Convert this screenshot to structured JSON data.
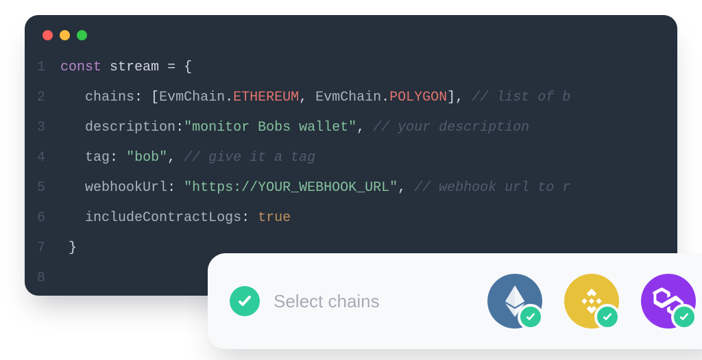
{
  "window": {
    "dots": {
      "red": "#fc605c",
      "yellow": "#fdbc40",
      "green": "#34c749"
    }
  },
  "code": {
    "line_numbers": [
      "1",
      "2",
      "3",
      "4",
      "5",
      "6",
      "7",
      "8"
    ],
    "l1": {
      "kw": "const",
      "id": "stream",
      "eq": " = ",
      "brace": "{"
    },
    "l2": {
      "key": "chains",
      "colon": ": [",
      "cls1": "EvmChain",
      "dot1": ".",
      "enum1": "ETHEREUM",
      "sep": ", ",
      "cls2": "EvmChain",
      "dot2": ".",
      "enum2": "POLYGON",
      "close": "], ",
      "comment": "// list of b"
    },
    "l3": {
      "key": "description",
      "colon": ":",
      "str": "\"monitor Bobs wallet\"",
      "after": ", ",
      "comment": "// your description"
    },
    "l4": {
      "key": "tag",
      "colon": ": ",
      "str": "\"bob\"",
      "after": ", ",
      "comment": "// give it a tag"
    },
    "l5": {
      "key": "webhookUrl",
      "colon": ": ",
      "str": "\"https://YOUR_WEBHOOK_URL\"",
      "after": ", ",
      "comment": "// webhook url to r"
    },
    "l6": {
      "key": "includeContractLogs",
      "colon": ": ",
      "bool": "true"
    },
    "l7": {
      "brace": "}"
    }
  },
  "card": {
    "label": "Select chains",
    "chains": {
      "eth": "ethereum",
      "bnb": "bnb",
      "poly": "polygon"
    }
  }
}
